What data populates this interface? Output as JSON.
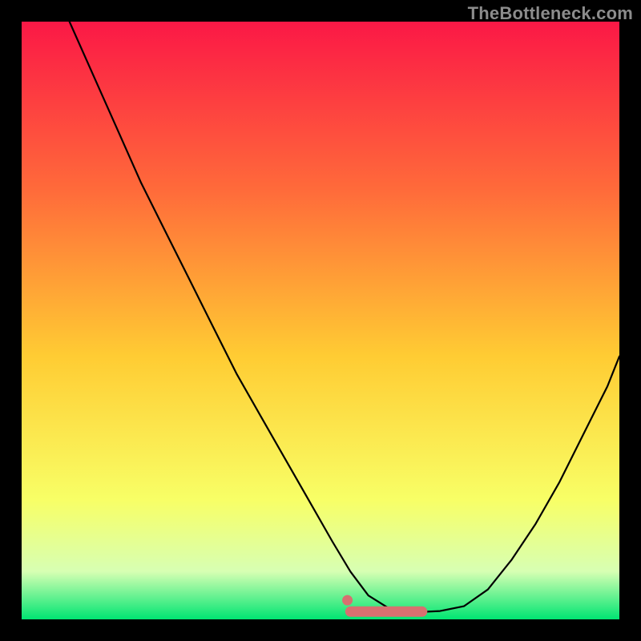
{
  "watermark": "TheBottleneck.com",
  "colors": {
    "gradient_top": "#fb1846",
    "gradient_upper": "#ff6a3a",
    "gradient_mid": "#ffcc33",
    "gradient_lower": "#f8ff66",
    "gradient_pale": "#d7ffb3",
    "gradient_bottom": "#00e572",
    "curve": "#000000",
    "accent": "#d77070"
  },
  "chart_data": {
    "type": "line",
    "title": "",
    "xlabel": "",
    "ylabel": "",
    "xlim": [
      0,
      100
    ],
    "ylim": [
      0,
      100
    ],
    "series": [
      {
        "name": "bottleneck-curve",
        "x": [
          8,
          12,
          16,
          20,
          24,
          28,
          32,
          36,
          40,
          44,
          48,
          52,
          55,
          58,
          62,
          66,
          70,
          74,
          78,
          82,
          86,
          90,
          94,
          98,
          100
        ],
        "y": [
          100,
          91,
          82,
          73,
          65,
          57,
          49,
          41,
          34,
          27,
          20,
          13,
          8,
          4,
          1.5,
          1.2,
          1.4,
          2.2,
          5,
          10,
          16,
          23,
          31,
          39,
          44
        ]
      }
    ],
    "annotations": [
      {
        "name": "min-band",
        "x_range": [
          55,
          67
        ],
        "y": 1.3
      },
      {
        "name": "min-point",
        "x": 54.5,
        "y": 3.2
      }
    ]
  }
}
